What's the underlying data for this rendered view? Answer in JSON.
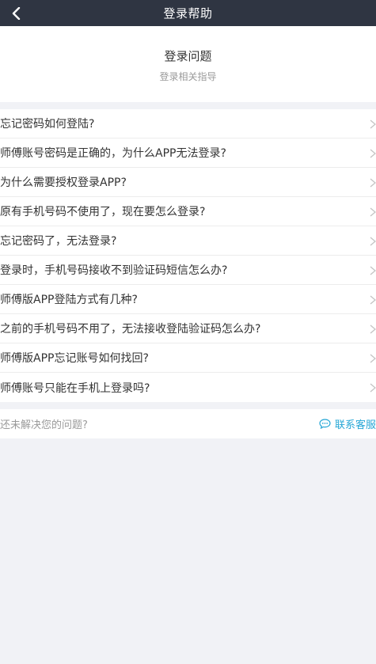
{
  "topbar": {
    "title": "登录帮助"
  },
  "header": {
    "title": "登录问题",
    "subtitle": "登录相关指导"
  },
  "questions": [
    "忘记密码如何登陆?",
    "师傅账号密码是正确的，为什么APP无法登录?",
    "为什么需要授权登录APP?",
    "原有手机号码不使用了，现在要怎么登录?",
    "忘记密码了，无法登录?",
    "登录时，手机号码接收不到验证码短信怎么办?",
    "师傅版APP登陆方式有几种?",
    "之前的手机号码不用了，无法接收登陆验证码怎么办?",
    "师傅版APP忘记账号如何找回?",
    "师傅账号只能在手机上登录吗?"
  ],
  "footer": {
    "question": "还未解决您的问题?",
    "contact_label": "联系客服"
  },
  "colors": {
    "topbar": "#2f3542",
    "accent": "#26a7d6",
    "background": "#f1f2f6"
  }
}
